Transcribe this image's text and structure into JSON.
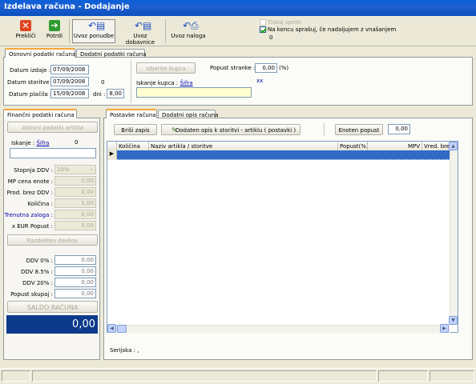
{
  "window": {
    "title": "Izdelava računa - Dodajanje"
  },
  "toolbar": {
    "preklici": "Prekliči",
    "potrdi": "Potrdi",
    "uvoz_ponudbe": "Uvoz ponudbe",
    "uvoz_dobavnice": "Uvoz dobavnice",
    "uvoz_naloga": "Uvoz naloga",
    "tiskaj_sproti": "Tiskaj sproti",
    "na_koncu": "Na koncu sprašuj, če nadaljujem z vnašanjem",
    "counter": "0"
  },
  "top_tabs": [
    "Osnovni podatki računa",
    "Dodatni podatki računa"
  ],
  "osnovni": {
    "datum_izdaje_label": "Datum izdaje :",
    "datum_izdaje": "07/09/2008",
    "datum_storitve_label": "Datum storitve :",
    "datum_storitve": "07/09/2008",
    "datum_storitve_extra": "0",
    "datum_placila_label": "Datum plačila :",
    "datum_placila": "15/09/2008",
    "dni_label": "dni :",
    "dni": "8,00",
    "izberite_kupca": "Izberite kupca",
    "popust_stranke_label": "Popust stranke :",
    "popust_stranke": "0,00",
    "popust_unit": "(%)",
    "iskanje_kupca_label": "Iskanje kupca :",
    "sifra": "Šifra",
    "xx": "xx"
  },
  "left_tab": "Finančni podatki računa",
  "fin": {
    "aktivni": "Aktivni podatki artikla",
    "iskanje_label": "Iskanje :",
    "sifra": "Šifra",
    "count": "0",
    "stopnja_label": "Stopnja DDV :",
    "stopnja": "20%",
    "mp_label": "MP cena enote :",
    "mp": "0,00",
    "prod_label": "Prod. brez DDV :",
    "prod": "0,00",
    "kolicina_label": "Količina :",
    "kolicina": "1,00",
    "trenutna_label": "Trenutna zaloga :",
    "trenutna": "0,00",
    "xeur_label": "x EUR  Popust :",
    "xeur": "0,00",
    "razdelitev": "Razdelitev davkov",
    "ddv0_label": "DDV 0% :",
    "ddv0": "0,00",
    "ddv85_label": "DDV 8.5% :",
    "ddv85": "0,00",
    "ddv20_label": "DDV 20% :",
    "ddv20": "0,00",
    "popust_label": "Popust skupaj :",
    "popust": "0,00",
    "saldo_label": "SALDO RAČUNA",
    "saldo": "0,00"
  },
  "right_tabs": [
    "Postavke računa",
    "Dodatni opis računa"
  ],
  "postavke": {
    "brisi": "Briši zapis",
    "dodaten": "Dodaten opis k storitvi - artiklu ( postavki )",
    "enoten": "Enoten popust",
    "enoten_val": "0,00",
    "columns": [
      "Količina",
      "Naziv artikla / storitve",
      "Popust(%)",
      "MPV",
      "Vred. brez DDV"
    ],
    "serijska": "Serijska :  ,"
  },
  "colors": {
    "titlebar": "#0a5fd8",
    "saldo_bg": "#0c3a8a",
    "row_select": "#316ac5"
  }
}
